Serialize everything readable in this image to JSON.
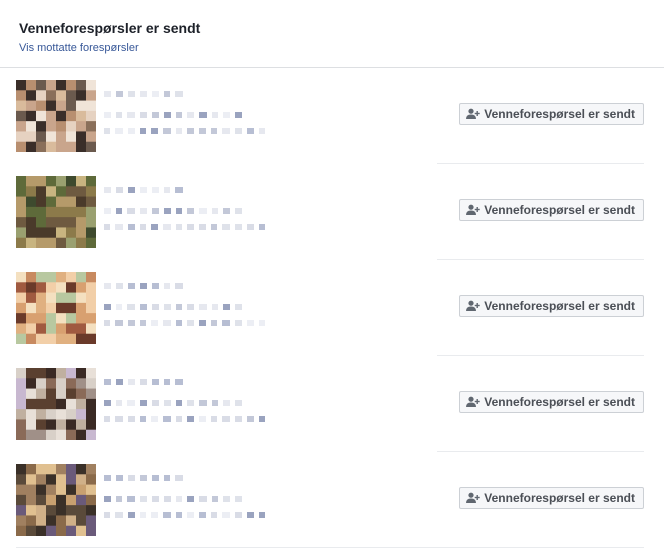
{
  "header": {
    "title": "Venneforespørsler er sendt",
    "view_received_link": "Vis mottatte forespørsler"
  },
  "requests": [
    {
      "button_label": "Venneforespørsel er sendt",
      "avatar_palette": [
        "#6b5a4e",
        "#c9a58c",
        "#e6d2c1",
        "#3a2e29",
        "#b88f70",
        "#d9bb9c",
        "#8a6f5a",
        "#f0e4d8"
      ]
    },
    {
      "button_label": "Venneforespørsel er sendt",
      "avatar_palette": [
        "#5e6a3a",
        "#8c7a4a",
        "#3e4a2e",
        "#b59a6a",
        "#6e5a40",
        "#9aa070",
        "#4a3a2a",
        "#c8b480"
      ]
    },
    {
      "button_label": "Venneforespørsel er sendt",
      "avatar_palette": [
        "#e0b080",
        "#f2cfa8",
        "#c88a60",
        "#a05a40",
        "#f4e0c0",
        "#d8a070",
        "#b8c8a0",
        "#6a3a2a"
      ]
    },
    {
      "button_label": "Venneforespørsel er sendt",
      "avatar_palette": [
        "#d8d0c8",
        "#5a4030",
        "#c0b0a0",
        "#8a6a58",
        "#e8e0d8",
        "#3a2a24",
        "#a09088",
        "#c8b8d0"
      ]
    },
    {
      "button_label": "Venneforespørsel er sendt",
      "avatar_palette": [
        "#8a6a4a",
        "#c8a070",
        "#5a4a3a",
        "#e0c090",
        "#3a3028",
        "#a08060",
        "#6a5a7a",
        "#d0b088"
      ]
    }
  ]
}
